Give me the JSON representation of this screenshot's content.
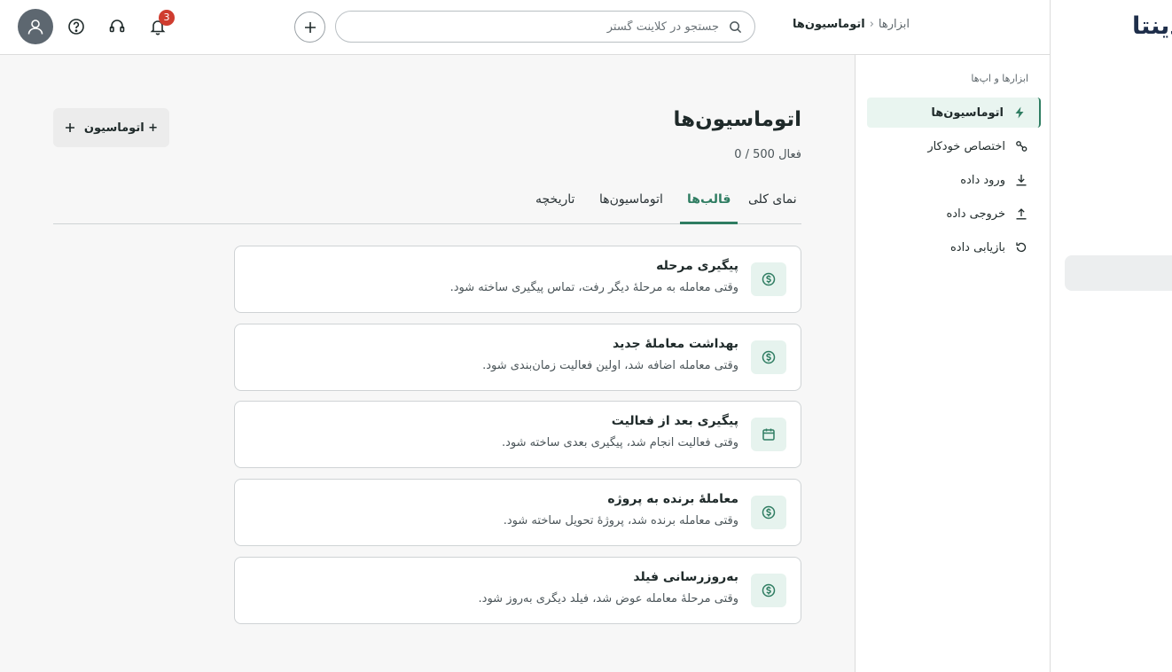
{
  "app": {
    "logo_text": "دینتا"
  },
  "header": {
    "notifications_count": "3",
    "search_placeholder": "جستجو در کلاینت گستر",
    "breadcrumb": {
      "parent": "ابزارها",
      "separator": "‹",
      "current": "اتوماسیون‌ها"
    },
    "icons": [
      "user-icon",
      "help-icon",
      "headset-icon",
      "bell-icon",
      "plus-icon",
      "search-icon"
    ]
  },
  "sidebar": {
    "title": "ابزارها و اپ‌ها",
    "items": [
      {
        "label": "اتوماسیون‌ها",
        "icon": "bolt-icon",
        "active": true
      },
      {
        "label": "اختصاص خودکار",
        "icon": "assign-icon",
        "active": false
      },
      {
        "label": "ورود داده",
        "icon": "import-icon",
        "active": false
      },
      {
        "label": "خروجی داده",
        "icon": "export-icon",
        "active": false
      },
      {
        "label": "بازیابی داده",
        "icon": "restore-icon",
        "active": false
      }
    ]
  },
  "main": {
    "title": "اتوماسیون‌ها",
    "active_count": "0 / 500 فعال",
    "new_button_label": "+ اتوماسیون",
    "tabs": [
      {
        "label": "نمای کلی",
        "active": false
      },
      {
        "label": "قالب‌ها",
        "active": true
      },
      {
        "label": "اتوماسیون‌ها",
        "active": false
      },
      {
        "label": "تاریخچه",
        "active": false
      }
    ],
    "templates": [
      {
        "title": "پیگیری مرحله",
        "description": "وقتی معامله به مرحلهٔ دیگر رفت، تماس پیگیری ساخته شود.",
        "icon": "dollar-icon"
      },
      {
        "title": "بهداشت معاملهٔ جدید",
        "description": "وقتی معامله اضافه شد، اولین فعالیت زمان‌بندی شود.",
        "icon": "dollar-icon"
      },
      {
        "title": "پیگیری بعد از فعالیت",
        "description": "وقتی فعالیت انجام شد، پیگیری بعدی ساخته شود.",
        "icon": "calendar-icon"
      },
      {
        "title": "معاملهٔ برنده به پروژه",
        "description": "وقتی معامله برنده شد، پروژهٔ تحویل ساخته شود.",
        "icon": "dollar-icon"
      },
      {
        "title": "به‌روزرسانی فیلد",
        "description": "وقتی مرحلهٔ معامله عوض شد، فیلد دیگری به‌روز شود.",
        "icon": "dollar-icon"
      }
    ]
  },
  "colors": {
    "accent": "#2f7d62",
    "accent_bg": "#e6f3ee",
    "badge": "#cf3c2f",
    "avatar": "#5d6770"
  }
}
